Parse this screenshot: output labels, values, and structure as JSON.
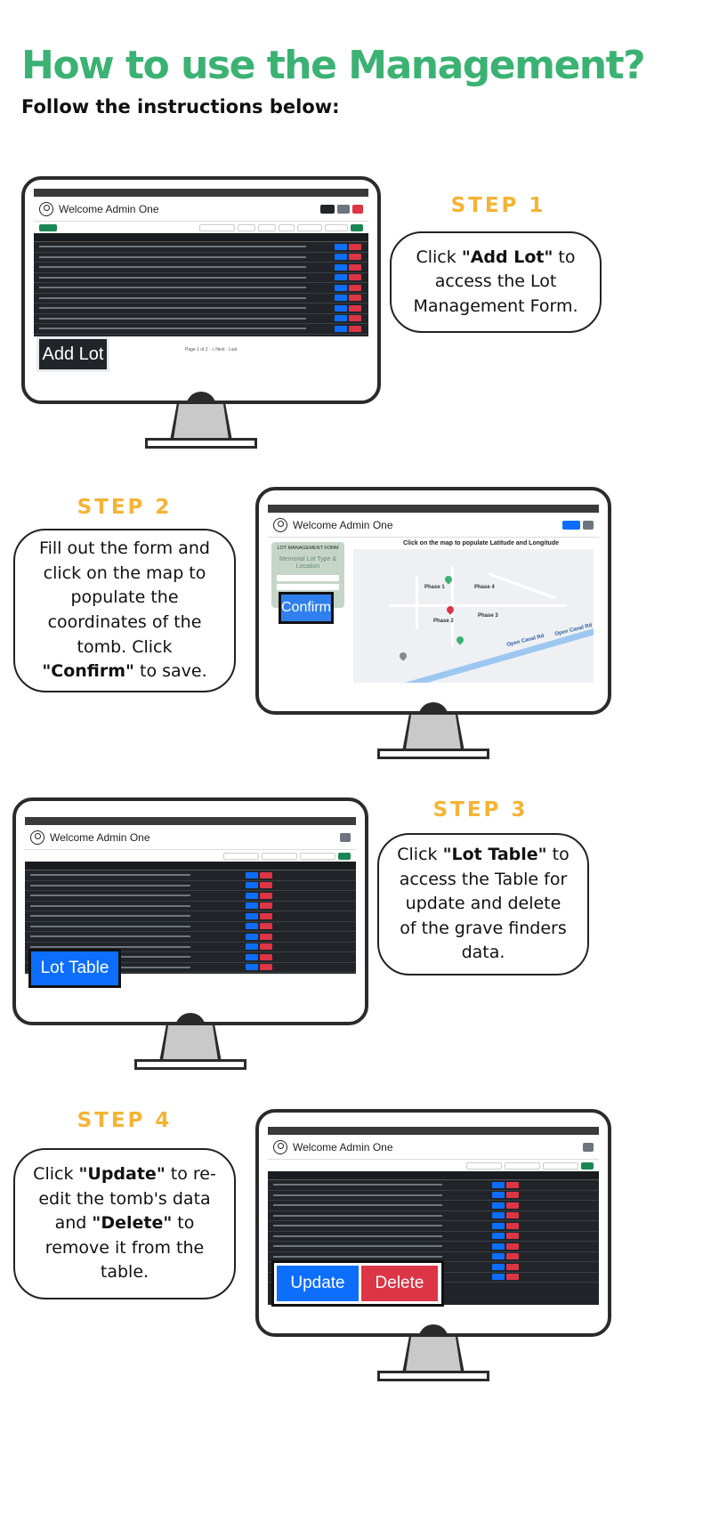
{
  "header": {
    "title": "How to use the Management?",
    "subtitle": "Follow the instructions below:"
  },
  "steps": [
    {
      "label": "STEP 1",
      "text_before": "Click ",
      "bold": "\"Add Lot\"",
      "text_after": " to access the Lot Management Form.",
      "screen": {
        "app_title": "Welcome Admin One",
        "callout": "Add Lot",
        "pager": "Page 1 of 2 · « Next · Last"
      }
    },
    {
      "label": "STEP 2",
      "text_before": "Fill out the form and click on the map to populate the coordinates of the tomb. Click ",
      "bold": "\"Confirm\"",
      "text_after": " to save.",
      "screen": {
        "app_title": "Welcome Admin One",
        "callout": "Confirm",
        "form_title": "LOT MANAGEMENT FORM",
        "form_subtitle": "Memorial Lot Type & Location",
        "map_heading": "Click on the map to populate Latitude and Longitude",
        "map_labels": [
          "Phase 1",
          "Phase 4",
          "Phase 3",
          "Phase 2",
          "Open Canal Rd",
          "Open Canal Rd"
        ]
      }
    },
    {
      "label": "STEP 3",
      "text_before": "Click ",
      "bold": "\"Lot Table\"",
      "text_after": " to access the Table for update and delete of the grave finders data.",
      "screen": {
        "app_title": "Welcome Admin One",
        "callout": "Lot Table"
      }
    },
    {
      "label": "STEP 4",
      "text_before": "Click ",
      "bold": "\"Update\"",
      "text_middle": " to re-edit the tomb's data and ",
      "bold2": "\"Delete\"",
      "text_after": " to remove it from the table.",
      "screen": {
        "app_title": "Welcome Admin One",
        "callout_update": "Update",
        "callout_delete": "Delete"
      }
    }
  ],
  "colors": {
    "title_green": "#3bb273",
    "step_orange": "#f5b335",
    "update_blue": "#0d6efd",
    "delete_red": "#dc3545",
    "addlot_dark": "#212529"
  }
}
